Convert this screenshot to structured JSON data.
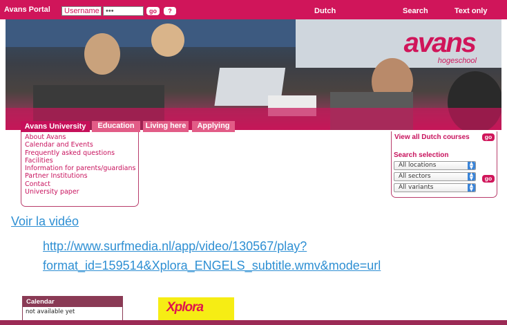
{
  "topbar": {
    "brand": "Avans Portal",
    "username_placeholder": "Username",
    "password_value": "•••",
    "go_label": "go",
    "help_label": "?",
    "dutch_label": "Dutch",
    "search_label": "Search",
    "text_only_label": "Text only"
  },
  "banner": {
    "logo_word": "avans",
    "logo_sub": "hogeschool"
  },
  "nav": {
    "tabs": [
      {
        "label": "Avans University"
      },
      {
        "label": "Education"
      },
      {
        "label": "Living here"
      },
      {
        "label": "Applying"
      }
    ]
  },
  "menu": {
    "items": [
      "About Avans",
      "Calendar and Events",
      "Frequently asked questions",
      "Facilities",
      "Information for parents/guardians",
      "Partner Institutions",
      "Contact",
      "University paper"
    ]
  },
  "panel": {
    "view_all_label": "View all Dutch courses",
    "go_label": "go",
    "search_selection_label": "Search selection",
    "selects": [
      "All locations",
      "All sectors",
      "All variants"
    ],
    "go_search_label": "go"
  },
  "video": {
    "link_label": "Voir la vidéo",
    "url_line1": "http://www.surfmedia.nl/app/video/130567/play?",
    "url_line2": "format_id=159514&Xplora_ENGELS_subtitle.wmv&mode=url"
  },
  "calendar": {
    "title": "Calendar",
    "body": "not available yet"
  },
  "xplora": {
    "logo_text": "Xplora"
  },
  "colors": {
    "brand": "#d0155a",
    "link": "#2e8fd3",
    "dark_accent": "#8a3a55",
    "xplora_bg": "#f6ed14"
  }
}
